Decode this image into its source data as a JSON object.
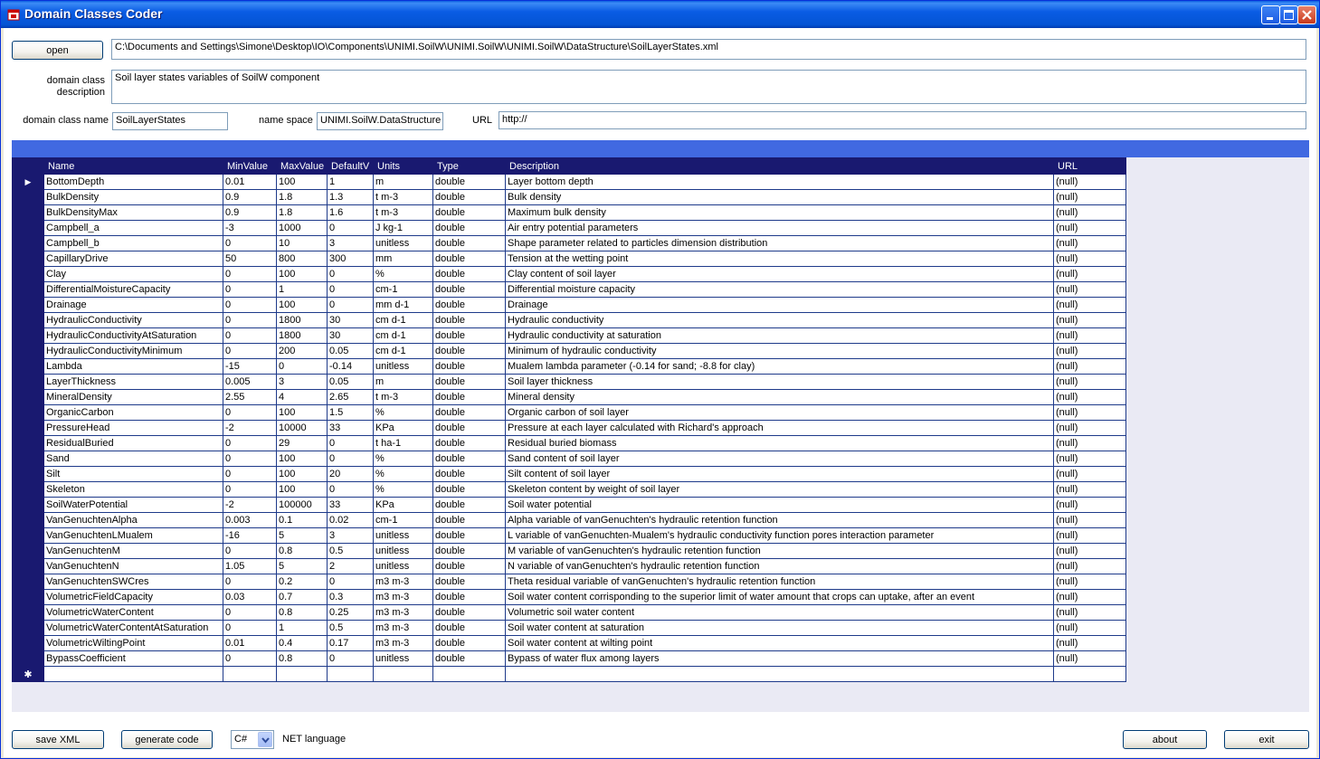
{
  "window": {
    "title": "Domain Classes Coder",
    "accent": "#0a5ce4"
  },
  "header": {
    "open_label": "open",
    "file_path": "C:\\Documents and Settings\\Simone\\Desktop\\IO\\Components\\UNIMI.SoilW\\UNIMI.SoilW\\UNIMI.SoilW\\DataStructure\\SoilLayerStates.xml",
    "description_label": "domain class description",
    "description_value": "Soil layer states variables of SoilW component",
    "class_name_label": "domain class name",
    "class_name_value": "SoilLayerStates",
    "namespace_label": "name space",
    "namespace_value": "UNIMI.SoilW.DataStructure",
    "url_label": "URL",
    "url_value": "http://"
  },
  "grid": {
    "header_color": "#191970",
    "strip_color": "#4169e1",
    "current_row_marker": "▶",
    "new_row_marker": "✱",
    "columns": [
      "Name",
      "MinValue",
      "MaxValue",
      "DefaultV",
      "Units",
      "Type",
      "Description",
      "URL"
    ],
    "rows": [
      [
        "BottomDepth",
        "0.01",
        "100",
        "1",
        "m",
        "double",
        "Layer bottom depth",
        "(null)"
      ],
      [
        "BulkDensity",
        "0.9",
        "1.8",
        "1.3",
        "t m-3",
        "double",
        "Bulk density",
        "(null)"
      ],
      [
        "BulkDensityMax",
        "0.9",
        "1.8",
        "1.6",
        "t m-3",
        "double",
        "Maximum bulk density",
        "(null)"
      ],
      [
        "Campbell_a",
        "-3",
        "1000",
        "0",
        "J kg-1",
        "double",
        "Air entry potential parameters",
        "(null)"
      ],
      [
        "Campbell_b",
        "0",
        "10",
        "3",
        "unitless",
        "double",
        "Shape parameter related to particles dimension distribution",
        "(null)"
      ],
      [
        "CapillaryDrive",
        "50",
        "800",
        "300",
        "mm",
        "double",
        "Tension at the wetting point",
        "(null)"
      ],
      [
        "Clay",
        "0",
        "100",
        "0",
        "%",
        "double",
        "Clay content of soil layer",
        "(null)"
      ],
      [
        "DifferentialMoistureCapacity",
        "0",
        "1",
        "0",
        "cm-1",
        "double",
        "Differential  moisture capacity",
        "(null)"
      ],
      [
        "Drainage",
        "0",
        "100",
        "0",
        "mm d-1",
        "double",
        "Drainage",
        "(null)"
      ],
      [
        "HydraulicConductivity",
        "0",
        "1800",
        "30",
        "cm d-1",
        "double",
        "Hydraulic conductivity",
        "(null)"
      ],
      [
        "HydraulicConductivityAtSaturation",
        "0",
        "1800",
        "30",
        "cm d-1",
        "double",
        "Hydraulic conductivity at saturation",
        "(null)"
      ],
      [
        "HydraulicConductivityMinimum",
        "0",
        "200",
        "0.05",
        "cm d-1",
        "double",
        "Minimum of hydraulic conductivity",
        "(null)"
      ],
      [
        "Lambda",
        "-15",
        "0",
        "-0.14",
        "unitless",
        "double",
        "Mualem lambda parameter (-0.14 for sand; -8.8 for clay)",
        "(null)"
      ],
      [
        "LayerThickness",
        "0.005",
        "3",
        "0.05",
        "m",
        "double",
        "Soil layer thickness",
        "(null)"
      ],
      [
        "MineralDensity",
        "2.55",
        "4",
        "2.65",
        "t m-3",
        "double",
        "Mineral density",
        "(null)"
      ],
      [
        "OrganicCarbon",
        "0",
        "100",
        "1.5",
        "%",
        "double",
        "Organic carbon of soil layer",
        "(null)"
      ],
      [
        "PressureHead",
        "-2",
        "10000",
        "33",
        "KPa",
        "double",
        "Pressure at each layer calculated with Richard's approach",
        "(null)"
      ],
      [
        "ResidualBuried",
        "0",
        "29",
        "0",
        "t ha-1",
        "double",
        "Residual buried biomass",
        "(null)"
      ],
      [
        "Sand",
        "0",
        "100",
        "0",
        "%",
        "double",
        "Sand content of soil layer",
        "(null)"
      ],
      [
        "Silt",
        "0",
        "100",
        "20",
        "%",
        "double",
        "Silt content of soil layer",
        "(null)"
      ],
      [
        "Skeleton",
        "0",
        "100",
        "0",
        "%",
        "double",
        "Skeleton content by weight of soil layer",
        "(null)"
      ],
      [
        "SoilWaterPotential",
        "-2",
        "100000",
        "33",
        "KPa",
        "double",
        "Soil water potential",
        "(null)"
      ],
      [
        "VanGenuchtenAlpha",
        "0.003",
        "0.1",
        "0.02",
        "cm-1",
        "double",
        "Alpha variable of vanGenuchten's hydraulic retention function",
        "(null)"
      ],
      [
        "VanGenuchtenLMualem",
        "-16",
        "5",
        "3",
        "unitless",
        "double",
        "L variable of vanGenuchten-Mualem's hydraulic conductivity function pores interaction parameter",
        "(null)"
      ],
      [
        "VanGenuchtenM",
        "0",
        "0.8",
        "0.5",
        "unitless",
        "double",
        "M variable of vanGenuchten's hydraulic retention function",
        "(null)"
      ],
      [
        "VanGenuchtenN",
        "1.05",
        "5",
        "2",
        "unitless",
        "double",
        "N variable of vanGenuchten's hydraulic retention function",
        "(null)"
      ],
      [
        "VanGenuchtenSWCres",
        "0",
        "0.2",
        "0",
        "m3 m-3",
        "double",
        "Theta residual variable of vanGenuchten's hydraulic retention function",
        "(null)"
      ],
      [
        "VolumetricFieldCapacity",
        "0.03",
        "0.7",
        "0.3",
        "m3 m-3",
        "double",
        "Soil water content corrisponding to the superior limit of water amount that crops can uptake, after an event",
        "(null)"
      ],
      [
        "VolumetricWaterContent",
        "0",
        "0.8",
        "0.25",
        "m3 m-3",
        "double",
        "Volumetric soil water content",
        "(null)"
      ],
      [
        "VolumetricWaterContentAtSaturation",
        "0",
        "1",
        "0.5",
        "m3 m-3",
        "double",
        "Soil water content at saturation",
        "(null)"
      ],
      [
        "VolumetricWiltingPoint",
        "0.01",
        "0.4",
        "0.17",
        "m3 m-3",
        "double",
        "Soil water content at wilting point",
        "(null)"
      ],
      [
        "BypassCoefficient",
        "0",
        "0.8",
        "0",
        "unitless",
        "double",
        "Bypass of water flux among layers",
        "(null)"
      ]
    ]
  },
  "footer": {
    "save_label": "save XML",
    "generate_label": "generate code",
    "language_value": "C#",
    "language_label": "NET language",
    "about_label": "about",
    "exit_label": "exit"
  },
  "icons": {
    "app": "app-icon",
    "minimize": "minimize-icon",
    "maximize": "maximize-icon",
    "close": "close-icon",
    "dropdown": "chevron-down-icon"
  }
}
